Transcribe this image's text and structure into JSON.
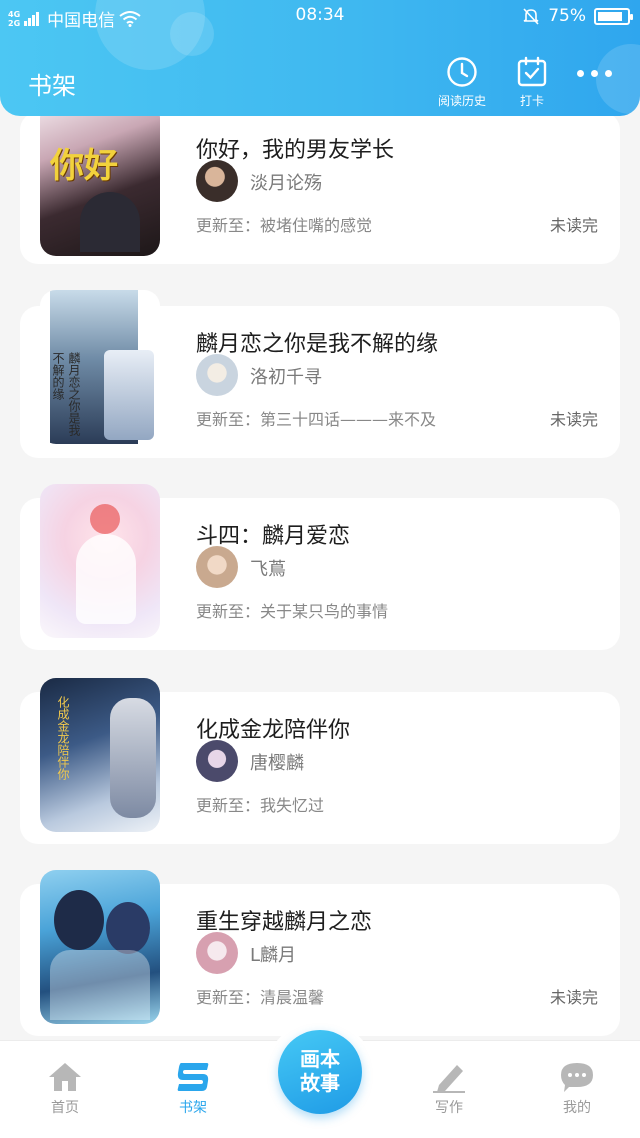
{
  "status_bar": {
    "network_top": "4G",
    "network_bottom": "2G",
    "carrier": "中国电信",
    "time": "08:34",
    "battery": "75%"
  },
  "header": {
    "title": "书架",
    "history_label": "阅读历史",
    "checkin_label": "打卡",
    "icons": [
      "clock-icon",
      "calendar-check-icon",
      "more-icon"
    ]
  },
  "books": [
    {
      "title": "你好，我的男友学长",
      "author": "淡月论殇",
      "update": "更新至：被堵住嘴的感觉",
      "status": "未读完",
      "cover_text": "你好"
    },
    {
      "title": "麟月恋之你是我不解的缘",
      "author": "洛初千寻",
      "update": "更新至：第三十四话———来不及",
      "status": "未读完",
      "cover_text": "麟月恋之你是我不解的缘"
    },
    {
      "title": "斗四：麟月爱恋",
      "author": "飞蔦",
      "update": "更新至：关于某只鸟的事情",
      "status": "",
      "cover_text": ""
    },
    {
      "title": "化成金龙陪伴你",
      "author": "唐樱麟",
      "update": "更新至：我失忆过",
      "status": "",
      "cover_text": "化成金龙陪伴你"
    },
    {
      "title": "重生穿越麟月之恋",
      "author": "L麟月",
      "update": "更新至：清晨温馨",
      "status": "未读完",
      "cover_text": ""
    }
  ],
  "bottom_nav": {
    "home": "首页",
    "bookshelf": "书架",
    "fab_line1": "画本",
    "fab_line2": "故事",
    "write": "写作",
    "mine": "我的",
    "active": "bookshelf"
  },
  "colors": {
    "accent": "#2aa6ec",
    "header_start": "#4cc7f3",
    "header_end": "#2fa6ee"
  }
}
